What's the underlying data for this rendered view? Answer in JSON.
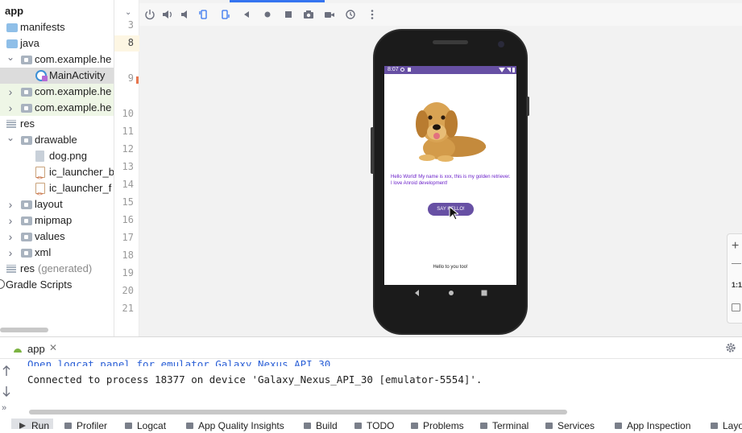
{
  "project_tree": {
    "root_label": "app",
    "items": [
      {
        "label": "manifests",
        "icon": "folder-icon",
        "expanded": null
      },
      {
        "label": "java",
        "icon": "folder-icon",
        "expanded": null
      },
      {
        "label": "com.example.he",
        "icon": "package-icon",
        "expanded": true
      },
      {
        "label": "MainActivity",
        "icon": "kotlin-class-icon",
        "expanded": null,
        "selected": true
      },
      {
        "label": "com.example.he",
        "icon": "package-icon",
        "expanded": false
      },
      {
        "label": "com.example.he",
        "icon": "package-icon",
        "expanded": false
      },
      {
        "label": "res",
        "icon": "res-folder-icon",
        "expanded": null
      },
      {
        "label": "drawable",
        "icon": "package-icon",
        "expanded": true
      },
      {
        "label": "dog.png",
        "icon": "image-file-icon",
        "expanded": null
      },
      {
        "label": "ic_launcher_b",
        "icon": "xml-file-icon",
        "expanded": null
      },
      {
        "label": "ic_launcher_f",
        "icon": "xml-file-icon",
        "expanded": null
      },
      {
        "label": "layout",
        "icon": "package-icon",
        "expanded": false
      },
      {
        "label": "mipmap",
        "icon": "package-icon",
        "expanded": false
      },
      {
        "label": "values",
        "icon": "package-icon",
        "expanded": false
      },
      {
        "label": "xml",
        "icon": "package-icon",
        "expanded": false
      },
      {
        "label": "res",
        "label_suffix": "(generated)",
        "icon": "res-folder-icon",
        "expanded": null
      },
      {
        "label": "Gradle Scripts",
        "icon": "gradle-icon",
        "expanded": null
      }
    ]
  },
  "gutter": {
    "line_numbers": [
      "3",
      "8",
      "9",
      "10",
      "11",
      "12",
      "13",
      "14",
      "15",
      "16",
      "17",
      "18",
      "19",
      "20",
      "21"
    ]
  },
  "emulator_toolbar": {
    "icons": [
      "power-icon",
      "volume-up-icon",
      "volume-down-icon",
      "rotate-left-icon",
      "rotate-right-icon",
      "back-icon",
      "home-icon",
      "overview-icon",
      "camera-icon",
      "record-icon",
      "snapshot-icon",
      "more-icon"
    ]
  },
  "phone": {
    "status_time": "8:07",
    "app_text": "Hello World! My name is xxx, this is my golden retriever. I love Anroid development!",
    "button_label": "SAY HELLO!",
    "result_text": "Hello to you too!",
    "accent_color": "#6750a4",
    "text_color": "#6a1fc9"
  },
  "right_panel": {
    "zoom_label": "1:1"
  },
  "run_panel": {
    "tab_label": "app",
    "console_lines": [
      {
        "text": "Open logcat panel for emulator Galaxy Nexus API 30",
        "is_link": true
      },
      {
        "text": "Connected to process 18377 on device 'Galaxy_Nexus_API_30 [emulator-5554]'.",
        "is_link": false
      }
    ]
  },
  "tool_strip": {
    "items": [
      "Run",
      "Profiler",
      "Logcat",
      "App Quality Insights",
      "Build",
      "TODO",
      "Problems",
      "Terminal",
      "Services",
      "App Inspection",
      "Layo"
    ]
  }
}
